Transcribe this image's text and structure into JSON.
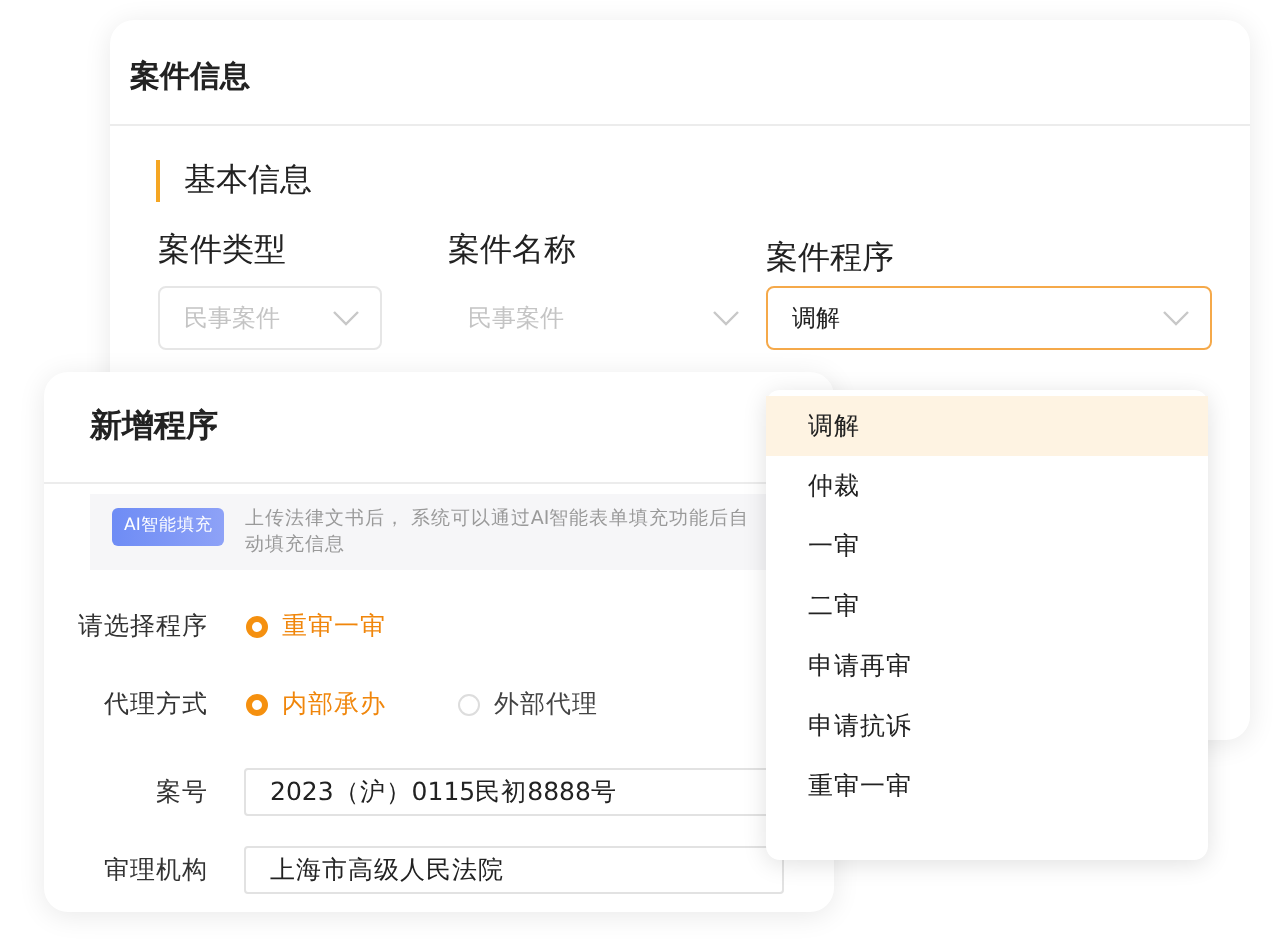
{
  "case_card": {
    "title": "案件信息",
    "section_title": "基本信息",
    "fields": [
      {
        "label": "案件类型",
        "kind": "select",
        "placeholder": "民事案件",
        "focused": false
      },
      {
        "label": "案件名称",
        "kind": "plain",
        "placeholder": "民事案件",
        "focused": false
      },
      {
        "label": "案件程序",
        "kind": "select",
        "value": "调解",
        "focused": true
      }
    ]
  },
  "dialog": {
    "title": "新增程序",
    "ai_badge": "AI智能填充",
    "ai_tip": "上传法律文书后， 系统可以通过AI智能表单填充功能后自动填充信息",
    "rows": [
      {
        "label": "请选择程序",
        "kind": "radio",
        "options": [
          {
            "label": "重审一审",
            "selected": true
          }
        ]
      },
      {
        "label": "代理方式",
        "kind": "radio",
        "options": [
          {
            "label": "内部承办",
            "selected": true
          },
          {
            "label": "外部代理",
            "selected": false
          }
        ]
      },
      {
        "label": "案号",
        "kind": "input",
        "value": "2023（沪）0115民初8888号"
      },
      {
        "label": "审理机构",
        "kind": "input",
        "value": "上海市高级人民法院"
      }
    ]
  },
  "dropdown": {
    "items": [
      {
        "label": "调解",
        "selected": true
      },
      {
        "label": "仲裁",
        "selected": false
      },
      {
        "label": "一审",
        "selected": false
      },
      {
        "label": "二审",
        "selected": false
      },
      {
        "label": "申请再审",
        "selected": false
      },
      {
        "label": "申请抗诉",
        "selected": false
      },
      {
        "label": "重审一审",
        "selected": false
      }
    ]
  }
}
